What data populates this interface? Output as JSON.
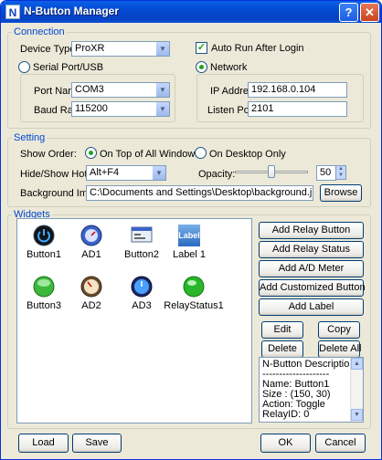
{
  "window": {
    "title": "N-Button Manager",
    "app_icon_glyph": "N"
  },
  "connection": {
    "title": "Connection",
    "device_type_label": "Device Type:",
    "device_type_value": "ProXR",
    "auto_run_label": "Auto Run After Login",
    "auto_run_checked": true,
    "serial_label": "Serial Port/USB",
    "network_label": "Network",
    "selected_mode": "network",
    "port_name_label": "Port Name:",
    "port_name_value": "COM3",
    "baud_rate_label": "Baud Rate:",
    "baud_rate_value": "115200",
    "ip_label": "IP Address:",
    "ip_value": "192.168.0.104",
    "listen_port_label": "Listen Port:",
    "listen_port_value": "2101"
  },
  "setting": {
    "title": "Setting",
    "show_order_label": "Show Order:",
    "on_top_label": "On Top of All Windows",
    "on_desktop_label": "On Desktop Only",
    "selected_order": "on_top",
    "hotkey_label": "Hide/Show Hotkey:",
    "hotkey_value": "Alt+F4",
    "opacity_label": "Opacity:",
    "opacity_value": "50",
    "background_label": "Background Image:",
    "background_value": "C:\\Documents and Settings\\Desktop\\background.jpg",
    "browse_label": "Browse"
  },
  "widgets": {
    "title": "Widgets",
    "items": [
      {
        "label": "Button1",
        "icon": "power-button-icon"
      },
      {
        "label": "AD1",
        "icon": "blue-gauge-icon"
      },
      {
        "label": "Button2",
        "icon": "window-button-icon"
      },
      {
        "label": "Label 1",
        "icon": "label-icon",
        "icon_text": "Label"
      },
      {
        "label": "Button3",
        "icon": "green-button-icon"
      },
      {
        "label": "AD2",
        "icon": "dial-gauge-icon"
      },
      {
        "label": "AD3",
        "icon": "blue-clock-gauge-icon"
      },
      {
        "label": "RelayStatus1",
        "icon": "green-led-icon"
      }
    ]
  },
  "actions": {
    "add_relay_button": "Add Relay Button",
    "add_relay_status": "Add Relay Status",
    "add_ad_meter": "Add A/D Meter",
    "add_customized_button": "Add Customized Button",
    "add_label": "Add Label",
    "edit": "Edit",
    "copy": "Copy",
    "delete": "Delete",
    "delete_all": "Delete All"
  },
  "description": {
    "title": "N-Button Description:",
    "separator": "--------------------",
    "name_line": "Name: Button1",
    "size_line": "Size : (150, 30)",
    "action_line": "Action: Toggle",
    "relay_line": "RelayID: 0"
  },
  "footer": {
    "load": "Load",
    "save": "Save",
    "ok": "OK",
    "cancel": "Cancel"
  }
}
